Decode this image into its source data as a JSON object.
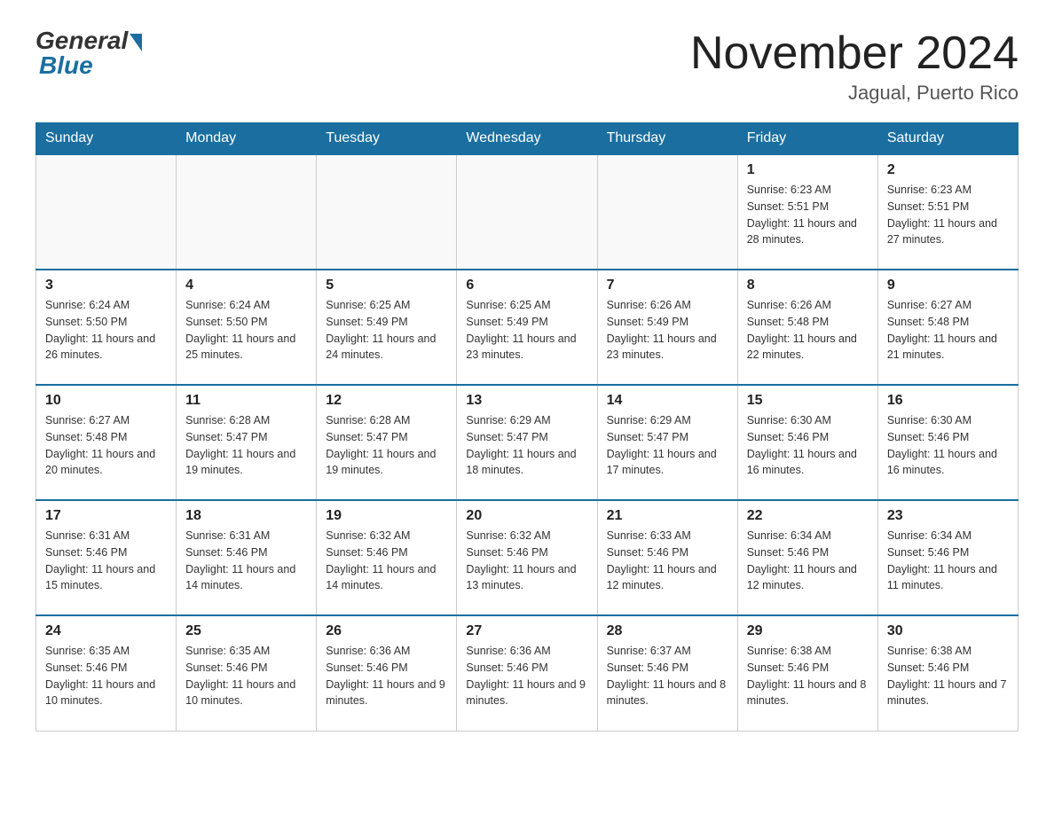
{
  "header": {
    "logo_general": "General",
    "logo_blue": "Blue",
    "month_title": "November 2024",
    "location": "Jagual, Puerto Rico"
  },
  "calendar": {
    "days_of_week": [
      "Sunday",
      "Monday",
      "Tuesday",
      "Wednesday",
      "Thursday",
      "Friday",
      "Saturday"
    ],
    "weeks": [
      [
        {
          "day": "",
          "info": ""
        },
        {
          "day": "",
          "info": ""
        },
        {
          "day": "",
          "info": ""
        },
        {
          "day": "",
          "info": ""
        },
        {
          "day": "",
          "info": ""
        },
        {
          "day": "1",
          "info": "Sunrise: 6:23 AM\nSunset: 5:51 PM\nDaylight: 11 hours and 28 minutes."
        },
        {
          "day": "2",
          "info": "Sunrise: 6:23 AM\nSunset: 5:51 PM\nDaylight: 11 hours and 27 minutes."
        }
      ],
      [
        {
          "day": "3",
          "info": "Sunrise: 6:24 AM\nSunset: 5:50 PM\nDaylight: 11 hours and 26 minutes."
        },
        {
          "day": "4",
          "info": "Sunrise: 6:24 AM\nSunset: 5:50 PM\nDaylight: 11 hours and 25 minutes."
        },
        {
          "day": "5",
          "info": "Sunrise: 6:25 AM\nSunset: 5:49 PM\nDaylight: 11 hours and 24 minutes."
        },
        {
          "day": "6",
          "info": "Sunrise: 6:25 AM\nSunset: 5:49 PM\nDaylight: 11 hours and 23 minutes."
        },
        {
          "day": "7",
          "info": "Sunrise: 6:26 AM\nSunset: 5:49 PM\nDaylight: 11 hours and 23 minutes."
        },
        {
          "day": "8",
          "info": "Sunrise: 6:26 AM\nSunset: 5:48 PM\nDaylight: 11 hours and 22 minutes."
        },
        {
          "day": "9",
          "info": "Sunrise: 6:27 AM\nSunset: 5:48 PM\nDaylight: 11 hours and 21 minutes."
        }
      ],
      [
        {
          "day": "10",
          "info": "Sunrise: 6:27 AM\nSunset: 5:48 PM\nDaylight: 11 hours and 20 minutes."
        },
        {
          "day": "11",
          "info": "Sunrise: 6:28 AM\nSunset: 5:47 PM\nDaylight: 11 hours and 19 minutes."
        },
        {
          "day": "12",
          "info": "Sunrise: 6:28 AM\nSunset: 5:47 PM\nDaylight: 11 hours and 19 minutes."
        },
        {
          "day": "13",
          "info": "Sunrise: 6:29 AM\nSunset: 5:47 PM\nDaylight: 11 hours and 18 minutes."
        },
        {
          "day": "14",
          "info": "Sunrise: 6:29 AM\nSunset: 5:47 PM\nDaylight: 11 hours and 17 minutes."
        },
        {
          "day": "15",
          "info": "Sunrise: 6:30 AM\nSunset: 5:46 PM\nDaylight: 11 hours and 16 minutes."
        },
        {
          "day": "16",
          "info": "Sunrise: 6:30 AM\nSunset: 5:46 PM\nDaylight: 11 hours and 16 minutes."
        }
      ],
      [
        {
          "day": "17",
          "info": "Sunrise: 6:31 AM\nSunset: 5:46 PM\nDaylight: 11 hours and 15 minutes."
        },
        {
          "day": "18",
          "info": "Sunrise: 6:31 AM\nSunset: 5:46 PM\nDaylight: 11 hours and 14 minutes."
        },
        {
          "day": "19",
          "info": "Sunrise: 6:32 AM\nSunset: 5:46 PM\nDaylight: 11 hours and 14 minutes."
        },
        {
          "day": "20",
          "info": "Sunrise: 6:32 AM\nSunset: 5:46 PM\nDaylight: 11 hours and 13 minutes."
        },
        {
          "day": "21",
          "info": "Sunrise: 6:33 AM\nSunset: 5:46 PM\nDaylight: 11 hours and 12 minutes."
        },
        {
          "day": "22",
          "info": "Sunrise: 6:34 AM\nSunset: 5:46 PM\nDaylight: 11 hours and 12 minutes."
        },
        {
          "day": "23",
          "info": "Sunrise: 6:34 AM\nSunset: 5:46 PM\nDaylight: 11 hours and 11 minutes."
        }
      ],
      [
        {
          "day": "24",
          "info": "Sunrise: 6:35 AM\nSunset: 5:46 PM\nDaylight: 11 hours and 10 minutes."
        },
        {
          "day": "25",
          "info": "Sunrise: 6:35 AM\nSunset: 5:46 PM\nDaylight: 11 hours and 10 minutes."
        },
        {
          "day": "26",
          "info": "Sunrise: 6:36 AM\nSunset: 5:46 PM\nDaylight: 11 hours and 9 minutes."
        },
        {
          "day": "27",
          "info": "Sunrise: 6:36 AM\nSunset: 5:46 PM\nDaylight: 11 hours and 9 minutes."
        },
        {
          "day": "28",
          "info": "Sunrise: 6:37 AM\nSunset: 5:46 PM\nDaylight: 11 hours and 8 minutes."
        },
        {
          "day": "29",
          "info": "Sunrise: 6:38 AM\nSunset: 5:46 PM\nDaylight: 11 hours and 8 minutes."
        },
        {
          "day": "30",
          "info": "Sunrise: 6:38 AM\nSunset: 5:46 PM\nDaylight: 11 hours and 7 minutes."
        }
      ]
    ]
  }
}
